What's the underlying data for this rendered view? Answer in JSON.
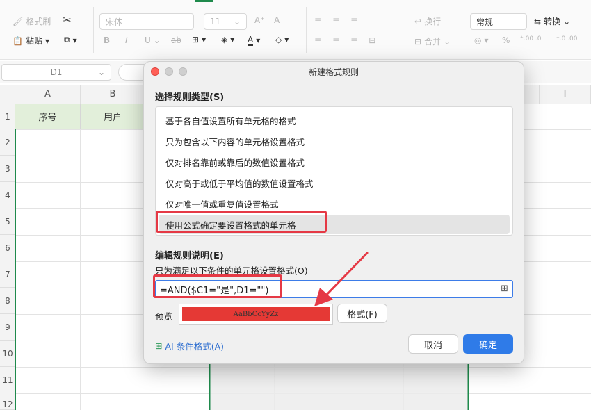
{
  "toolbar": {
    "format_painter": "格式刷",
    "cut": "✂",
    "paste": "粘贴",
    "paste_options": "▾",
    "font_name": "宋体",
    "font_size": "11",
    "font_grow": "A⁺",
    "font_shrink": "A⁻",
    "bold": "B",
    "italic": "I",
    "underline": "U",
    "strike": "ab",
    "wrap": "换行",
    "merge": "合并",
    "number_format": "常规",
    "convert": "转换",
    "percent": "%",
    "inc_decimal": "⁺.00 .0",
    "dec_decimal": "⁺.0 .00"
  },
  "namebox": {
    "value": "D1"
  },
  "columns": [
    "A",
    "B",
    "I"
  ],
  "rows": [
    "1",
    "2",
    "3",
    "4",
    "5",
    "6",
    "7",
    "8",
    "9",
    "10",
    "11",
    "12"
  ],
  "header_cells": {
    "a1": "序号",
    "b1": "用户"
  },
  "dialog": {
    "title": "新建格式规则",
    "section_rule_type": "选择规则类型(S)",
    "rules": [
      "基于各自值设置所有单元格的格式",
      "只为包含以下内容的单元格设置格式",
      "仅对排名靠前或靠后的数值设置格式",
      "仅对高于或低于平均值的数值设置格式",
      "仅对唯一值或重复值设置格式",
      "使用公式确定要设置格式的单元格"
    ],
    "section_edit": "编辑规则说明(E)",
    "condition_label": "只为满足以下条件的单元格设置格式(O)",
    "formula": "=AND($C1=\"是\",D1=\"\")",
    "preview_label": "预览",
    "preview_text": "AaBbCcYyZz",
    "format_button": "格式(F)",
    "ai_link": "AI 条件格式(A)",
    "cancel": "取消",
    "ok": "确定"
  },
  "colors": {
    "accent": "#2f7be8",
    "highlight": "#e53945",
    "preview_fill": "#e53935",
    "header_fill": "#e2efda"
  }
}
